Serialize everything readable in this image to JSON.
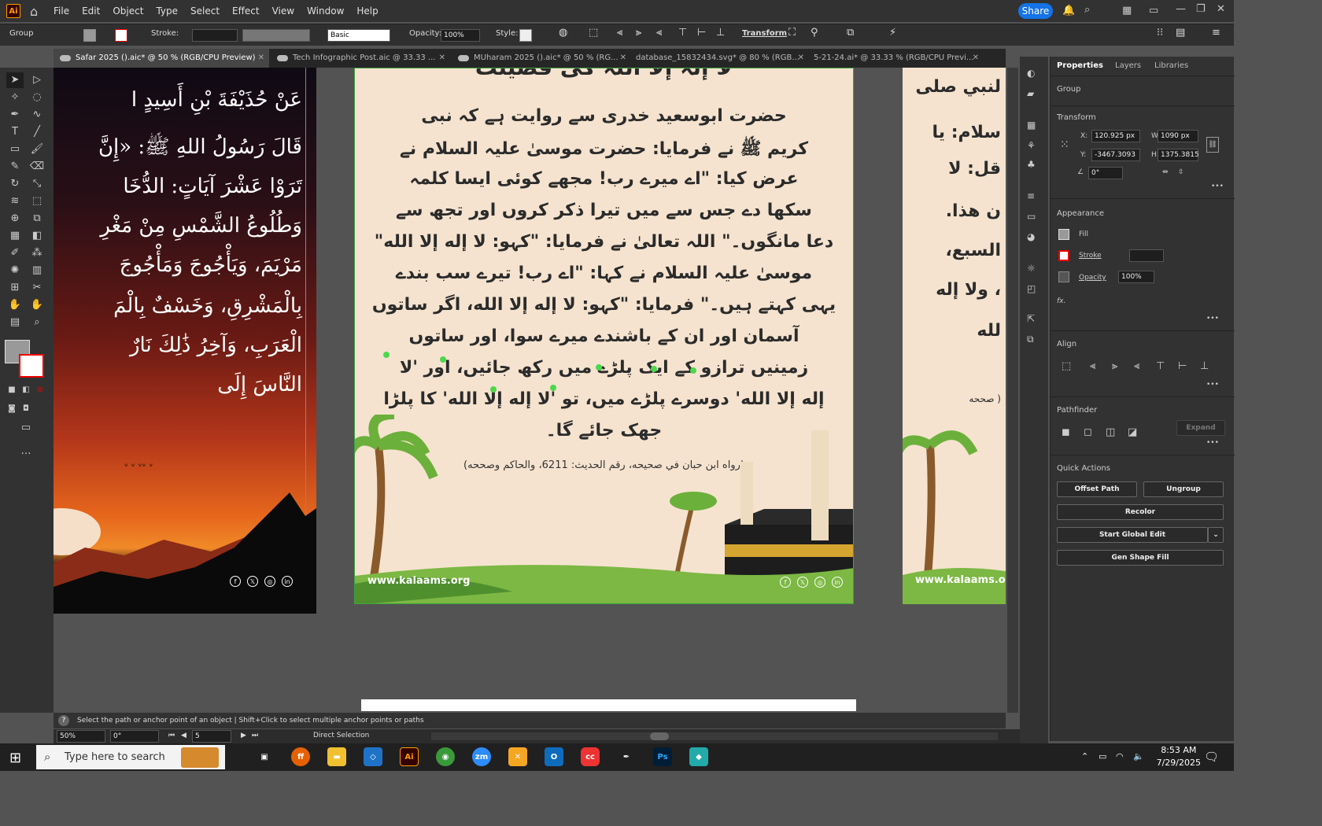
{
  "app": {
    "logo": "Ai",
    "share": "Share"
  },
  "menus": [
    "File",
    "Edit",
    "Object",
    "Type",
    "Select",
    "Effect",
    "View",
    "Window",
    "Help"
  ],
  "control_bar": {
    "selection": "Group",
    "stroke_label": "Stroke:",
    "brush": "Basic",
    "opacity_label": "Opacity:",
    "opacity": "100%",
    "style_label": "Style:",
    "transform_label": "Transform"
  },
  "tabs": [
    "Safar 2025 ().aic* @ 50 % (RGB/CPU Preview)",
    "Tech Infographic Post.aic @ 33.33 ...",
    "MUharam 2025 ().aic* @ 50 % (RG...",
    "database_15832434.svg* @ 80 % (RGB...",
    "5-21-24.ai* @ 33.33 % (RGB/CPU Previ..."
  ],
  "artboard1": {
    "lines": [
      "عَنْ حُذَيْفَةَ بْنِ أَسِيدٍ ا",
      "قَالَ رَسُولُ اللهِ ﷺ: «إِنَّ",
      "تَرَوْا عَشْرَ آيَاتٍ: الدُّخَا",
      "وَطُلُوعُ الشَّمْسِ مِنْ مَغْرِ",
      "مَرْيَمَ، وَيَأْجُوجَ وَمَأْجُوجَ",
      "بِالْمَشْرِقِ، وَخَسْفٌ بِالْمَ",
      "الْعَرَبِ، وَآخِرُ ذَٰلِكَ نَارٌ",
      "النَّاسَ إِلَى"
    ]
  },
  "artboard2": {
    "title": "لا إلٰہ إلا اللہ کی فضیلت",
    "lines": [
      "حضرت ابوسعید خدری سے روایت ہے کہ نبی",
      "کریم ﷺ نے فرمایا: حضرت موسیٰ علیہ السلام نے",
      "عرض کیا: \"اے میرے رب! مجھے کوئی ایسا کلمہ",
      "سکھا دے جس سے میں تیرا ذکر کروں اور تجھ سے",
      "دعا مانگوں۔\" اللہ تعالیٰ نے فرمایا: \"کہو: لا إله إلا الله\"",
      "موسیٰ علیہ السلام نے کہا: \"اے رب! تیرے سب بندے",
      "یہی کہتے ہیں۔\" فرمایا: \"کہو: لا إله إلا الله، اگر ساتوں",
      "آسمان اور ان کے باشندے میرے سوا، اور ساتوں",
      "زمینیں ترازو کے ایک پلڑے میں رکھ جائیں، اور 'لا",
      "إله إلا الله' دوسرے پلڑے میں، تو 'لا إله إلا الله' کا پلڑا",
      "جھک جائے گا۔"
    ],
    "reference": "(رواه ابن حبان في صحيحه، رقم الحديث: 6211، والحاكم وصححه)",
    "url": "www.kalaams.org"
  },
  "artboard3": {
    "lines": [
      "لنبي صلى",
      "سلام: يا",
      "قل: لا",
      "ن هذا.",
      "السبع،",
      "، ولا إله",
      "لله"
    ],
    "ref": "( صححه",
    "url": "www.kalaams.org"
  },
  "panel": {
    "tabs": [
      "Properties",
      "Layers",
      "Libraries"
    ],
    "selection": "Group",
    "transform": "Transform",
    "x_label": "X:",
    "x": "120.925 px",
    "y_label": "Y:",
    "y": "-3467.3093",
    "w_label": "W:",
    "w": "1090 px",
    "h_label": "H:",
    "h": "1375.3815",
    "angle": "0°",
    "appearance": "Appearance",
    "fill": "Fill",
    "stroke": "Stroke",
    "opacity_label": "Opacity",
    "opacity": "100%",
    "fx": "fx.",
    "align": "Align",
    "pathfinder": "Pathfinder",
    "expand": "Expand",
    "quick_actions": "Quick Actions",
    "offset_path": "Offset Path",
    "ungroup": "Ungroup",
    "recolor": "Recolor",
    "start_global_edit": "Start Global Edit",
    "gen_shape_fill": "Gen Shape Fill"
  },
  "status": {
    "hint": "Select the path or anchor point of an object  |  Shift+Click to select multiple anchor points or paths",
    "zoom": "50%",
    "rotate": "0°",
    "artboard": "5",
    "tool": "Direct Selection"
  },
  "taskbar": {
    "search": "Type here to search",
    "time": "8:53 AM",
    "date": "7/29/2025"
  }
}
